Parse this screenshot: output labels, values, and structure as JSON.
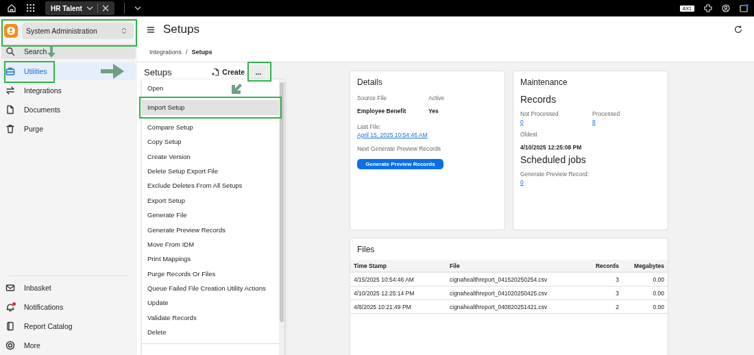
{
  "top_bar": {
    "tab": {
      "label": "HR Talent",
      "selected": true
    },
    "user_badge": "AX1"
  },
  "sidebar": {
    "role_select": {
      "value": "System Administration",
      "highlighted": true,
      "arrow": true
    },
    "search": {
      "label": "Search"
    },
    "items": [
      {
        "label": "Utilities",
        "kind": "toolbox",
        "selected": true,
        "highlighted": true,
        "arrow": true
      },
      {
        "label": "Integrations",
        "kind": "swap",
        "selected": false,
        "highlighted": false,
        "arrow": false
      },
      {
        "label": "Documents",
        "kind": "document",
        "selected": false,
        "highlighted": false,
        "arrow": false
      },
      {
        "label": "Purge",
        "kind": "trash",
        "selected": false,
        "highlighted": false,
        "arrow": false
      }
    ],
    "footer_items": [
      {
        "label": "Inbasket",
        "kind": "mail",
        "unread": false
      },
      {
        "label": "Notifications",
        "kind": "bell",
        "unread": true
      },
      {
        "label": "Report Catalog",
        "kind": "book",
        "unread": false
      },
      {
        "label": "More",
        "kind": "more",
        "unread": false
      }
    ]
  },
  "page": {
    "title": "Setups",
    "breadcrumb": [
      {
        "label": "Integrations",
        "current": false
      },
      {
        "label": "Setups",
        "current": true
      }
    ],
    "separator": "/"
  },
  "setups_panel": {
    "title": "Setups",
    "create_button": "Create",
    "more_button": {
      "label": "...",
      "highlighted": true,
      "arrow": true
    }
  },
  "actions_menu": {
    "items": [
      {
        "label": "Open",
        "selected": false,
        "highlighted": false
      },
      {
        "label": "Import Setup",
        "selected": true,
        "highlighted": true
      },
      {
        "label": "Compare Setup",
        "selected": false,
        "highlighted": false
      },
      {
        "label": "Copy Setup",
        "selected": false,
        "highlighted": false
      },
      {
        "label": "Create Version",
        "selected": false,
        "highlighted": false
      },
      {
        "label": "Delete Setup Export File",
        "selected": false,
        "highlighted": false
      },
      {
        "label": "Exclude Deletes From All Setups",
        "selected": false,
        "highlighted": false
      },
      {
        "label": "Export Setup",
        "selected": false,
        "highlighted": false
      },
      {
        "label": "Generate File",
        "selected": false,
        "highlighted": false
      },
      {
        "label": "Generate Preview Records",
        "selected": false,
        "highlighted": false
      },
      {
        "label": "Move From IDM",
        "selected": false,
        "highlighted": false
      },
      {
        "label": "Print Mappings",
        "selected": false,
        "highlighted": false
      },
      {
        "label": "Purge Records Or Files",
        "selected": false,
        "highlighted": false
      },
      {
        "label": "Queue Failed File Creation Utility Actions",
        "selected": false,
        "highlighted": false
      },
      {
        "label": "Update",
        "selected": false,
        "highlighted": false
      },
      {
        "label": "Validate Records",
        "selected": false,
        "highlighted": false
      },
      {
        "label": "Delete",
        "selected": false,
        "highlighted": false
      }
    ]
  },
  "details": {
    "title": "Details",
    "fields": [
      {
        "label": "Source File",
        "value": "Employee Benefit"
      },
      {
        "label": "Active",
        "value": "Yes"
      }
    ],
    "last_file": {
      "label": "Last File:",
      "link": "April 15, 2025 10:54:46 AM"
    },
    "next_label": "Next Generate Preview Records",
    "button": "Generate Preview Records"
  },
  "maintenance": {
    "title": "Maintenance",
    "records_heading": "Records",
    "counts": [
      {
        "label": "Not Processed",
        "value": "0"
      },
      {
        "label": "Processed",
        "value": "8"
      }
    ],
    "oldest": {
      "label": "Oldest",
      "value": "4/10/2025 12:25:08 PM"
    },
    "jobs_heading": "Scheduled jobs",
    "jobs": [
      {
        "label": "Generate Preview Record:",
        "value": "0"
      }
    ]
  },
  "files": {
    "title": "Files",
    "columns": [
      "Time Stamp",
      "File",
      "Records",
      "Megabytes"
    ],
    "rows": [
      [
        "4/15/2025 10:54:46 AM",
        "cignahealthreport_041520250254.csv",
        "3",
        "0.00"
      ],
      [
        "4/10/2025 12:25:14 PM",
        "cignahealthreport_041020250425.csv",
        "3",
        "0.00"
      ],
      [
        "4/8/2025 10:21:49 PM",
        "cignahealthreport_040820251421.csv",
        "2",
        "0.00"
      ]
    ]
  }
}
